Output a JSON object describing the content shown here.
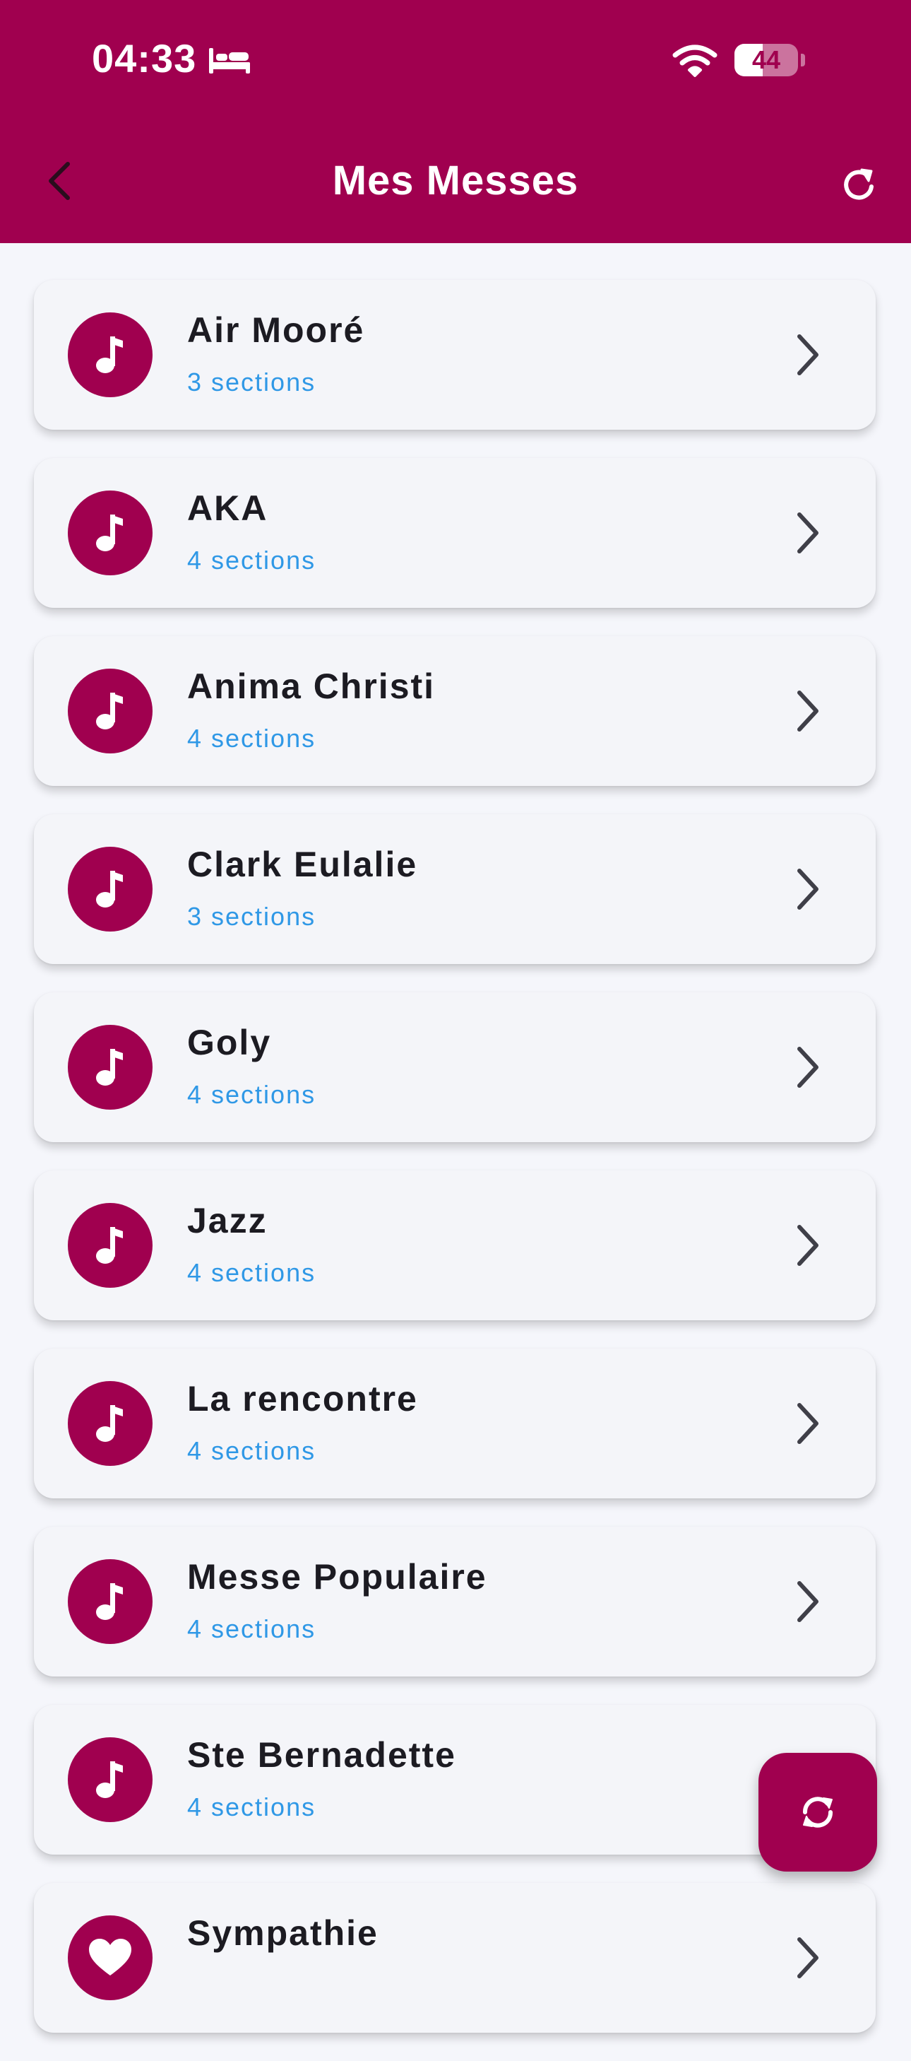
{
  "status_bar": {
    "time": "04:33",
    "battery": "44",
    "battery_level_percent": 44
  },
  "header": {
    "title": "Mes Messes",
    "back_icon": "chevron-left-icon",
    "refresh_icon": "refresh-icon"
  },
  "colors": {
    "primary": "#a0004f",
    "subtitle": "#2f98e6",
    "background": "#f5f6fb"
  },
  "masses": [
    {
      "title": "Air Mooré",
      "subtitle": "3 sections",
      "icon": "music-note-icon"
    },
    {
      "title": "AKA",
      "subtitle": "4 sections",
      "icon": "music-note-icon"
    },
    {
      "title": "Anima Christi",
      "subtitle": "4 sections",
      "icon": "music-note-icon"
    },
    {
      "title": "Clark Eulalie",
      "subtitle": "3 sections",
      "icon": "music-note-icon"
    },
    {
      "title": "Goly",
      "subtitle": "4 sections",
      "icon": "music-note-icon"
    },
    {
      "title": "Jazz",
      "subtitle": "4 sections",
      "icon": "music-note-icon"
    },
    {
      "title": "La rencontre",
      "subtitle": "4 sections",
      "icon": "music-note-icon"
    },
    {
      "title": "Messe Populaire",
      "subtitle": "4 sections",
      "icon": "music-note-icon"
    },
    {
      "title": "Ste Bernadette",
      "subtitle": "4 sections",
      "icon": "music-note-icon"
    },
    {
      "title": "Sympathie",
      "subtitle": "",
      "icon": "heart-icon"
    }
  ],
  "fab": {
    "icon": "sync-icon"
  }
}
